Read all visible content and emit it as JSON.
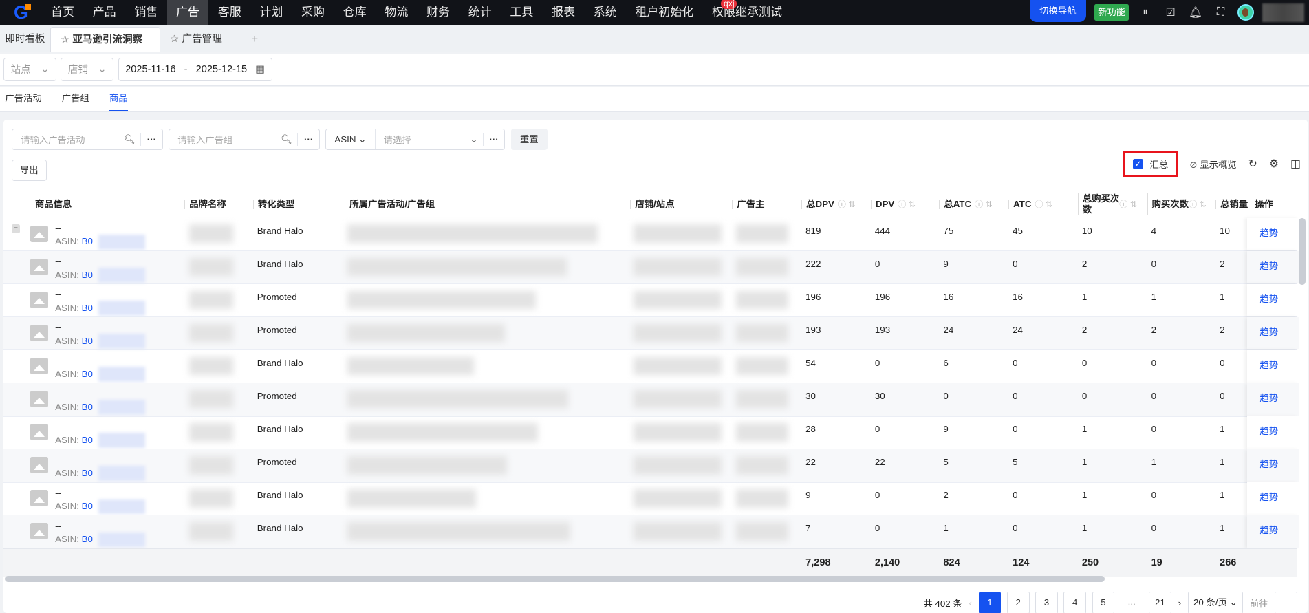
{
  "topnav": {
    "logo": "G",
    "items": [
      "首页",
      "产品",
      "销售",
      "广告",
      "客服",
      "计划",
      "采购",
      "仓库",
      "物流",
      "财务",
      "统计",
      "工具",
      "报表",
      "系统",
      "租户初始化",
      "权限继承测试"
    ],
    "active_index": 3,
    "badge": "qxj",
    "switch_nav": "切换导航",
    "new_feature": "新功能"
  },
  "tabs": {
    "dashboard": "即时看板",
    "items": [
      {
        "label": "亚马逊引流洞察"
      },
      {
        "label": "广告管理"
      }
    ],
    "add": "+"
  },
  "filters": {
    "site": "站点",
    "shop": "店铺",
    "date_start": "2025-11-16",
    "date_sep": "-",
    "date_end": "2025-12-15"
  },
  "subtabs": [
    "广告活动",
    "广告组",
    "商品"
  ],
  "search": {
    "campaign_placeholder": "请输入广告活动",
    "group_placeholder": "请输入广告组",
    "asin_type": "ASIN",
    "asin_placeholder": "请选择",
    "reset": "重置",
    "export": "导出"
  },
  "tools": {
    "summary": "汇总",
    "show_overview": "显示概览"
  },
  "columns": [
    "商品信息",
    "品牌名称",
    "转化类型",
    "所属广告活动/广告组",
    "店铺/站点",
    "广告主",
    "总DPV",
    "DPV",
    "总ATC",
    "ATC",
    "总购买次数",
    "购买次数",
    "总销量",
    "操作"
  ],
  "rows": [
    {
      "name": "--",
      "asin_label": "ASIN:",
      "asin": "B0",
      "type": "Brand Halo",
      "total_dpv": "819",
      "dpv": "444",
      "total_atc": "75",
      "atc": "45",
      "total_purchases": "10",
      "purchases": "4",
      "total_sales": "10",
      "op": "趋势"
    },
    {
      "name": "--",
      "asin_label": "ASIN:",
      "asin": "B0",
      "type": "Brand Halo",
      "total_dpv": "222",
      "dpv": "0",
      "total_atc": "9",
      "atc": "0",
      "total_purchases": "2",
      "purchases": "0",
      "total_sales": "2",
      "op": "趋势"
    },
    {
      "name": "--",
      "asin_label": "ASIN:",
      "asin": "B0",
      "type": "Promoted",
      "total_dpv": "196",
      "dpv": "196",
      "total_atc": "16",
      "atc": "16",
      "total_purchases": "1",
      "purchases": "1",
      "total_sales": "1",
      "op": "趋势"
    },
    {
      "name": "--",
      "asin_label": "ASIN:",
      "asin": "B0",
      "type": "Promoted",
      "total_dpv": "193",
      "dpv": "193",
      "total_atc": "24",
      "atc": "24",
      "total_purchases": "2",
      "purchases": "2",
      "total_sales": "2",
      "op": "趋势"
    },
    {
      "name": "--",
      "asin_label": "ASIN:",
      "asin": "B0",
      "type": "Brand Halo",
      "total_dpv": "54",
      "dpv": "0",
      "total_atc": "6",
      "atc": "0",
      "total_purchases": "0",
      "purchases": "0",
      "total_sales": "0",
      "op": "趋势"
    },
    {
      "name": "--",
      "asin_label": "ASIN:",
      "asin": "B0",
      "type": "Promoted",
      "total_dpv": "30",
      "dpv": "30",
      "total_atc": "0",
      "atc": "0",
      "total_purchases": "0",
      "purchases": "0",
      "total_sales": "0",
      "op": "趋势"
    },
    {
      "name": "--",
      "asin_label": "ASIN:",
      "asin": "B0",
      "type": "Brand Halo",
      "total_dpv": "28",
      "dpv": "0",
      "total_atc": "9",
      "atc": "0",
      "total_purchases": "1",
      "purchases": "0",
      "total_sales": "1",
      "op": "趋势"
    },
    {
      "name": "--",
      "asin_label": "ASIN:",
      "asin": "B0",
      "type": "Promoted",
      "total_dpv": "22",
      "dpv": "22",
      "total_atc": "5",
      "atc": "5",
      "total_purchases": "1",
      "purchases": "1",
      "total_sales": "1",
      "op": "趋势"
    },
    {
      "name": "--",
      "asin_label": "ASIN:",
      "asin": "B0",
      "type": "Brand Halo",
      "total_dpv": "9",
      "dpv": "0",
      "total_atc": "2",
      "atc": "0",
      "total_purchases": "1",
      "purchases": "0",
      "total_sales": "1",
      "op": "趋势"
    },
    {
      "name": "--",
      "asin_label": "ASIN:",
      "asin": "B0",
      "type": "Brand Halo",
      "total_dpv": "7",
      "dpv": "0",
      "total_atc": "1",
      "atc": "0",
      "total_purchases": "1",
      "purchases": "0",
      "total_sales": "1",
      "op": "趋势"
    }
  ],
  "summary": {
    "total_dpv": "7,298",
    "dpv": "2,140",
    "total_atc": "824",
    "atc": "124",
    "total_purchases": "250",
    "purchases": "19",
    "total_sales": "266"
  },
  "pagination": {
    "total": "共 402 条",
    "pages": [
      "1",
      "2",
      "3",
      "4",
      "5",
      "...",
      "21"
    ],
    "current": "1",
    "page_size": "20 条/页",
    "goto": "前往"
  }
}
